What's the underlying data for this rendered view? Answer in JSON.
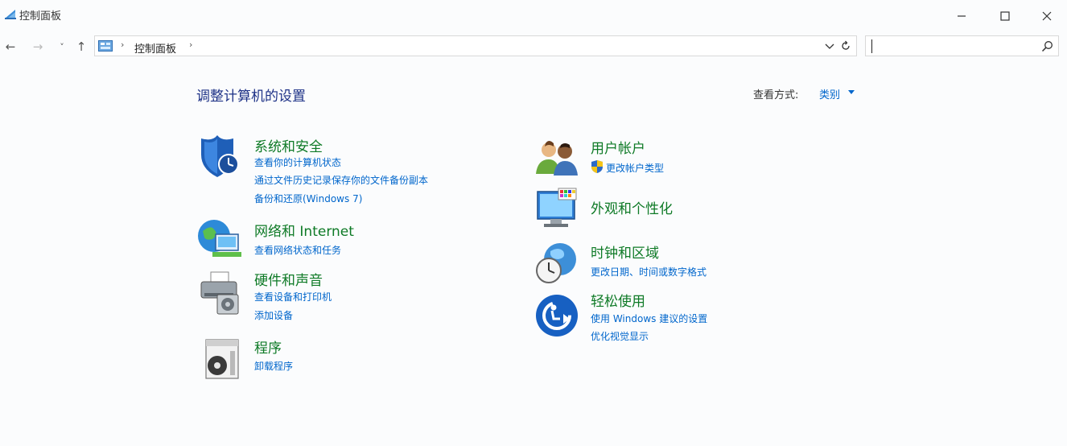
{
  "window": {
    "title": "控制面板",
    "minimize_glyph": "—",
    "maximize_glyph": "☐",
    "close_glyph": "✕"
  },
  "nav": {
    "back": "←",
    "forward": "→",
    "recent": "˅",
    "up": "↑"
  },
  "address": {
    "breadcrumb": "控制面板",
    "separator": "›"
  },
  "search": {
    "value": "",
    "placeholder": ""
  },
  "main": {
    "heading": "调整计算机的设置",
    "view_by_label": "查看方式:",
    "view_by_value": "类别"
  },
  "categories_left": [
    {
      "title": "系统和安全",
      "icon": "shield-icon",
      "links": [
        "查看你的计算机状态",
        "通过文件历史记录保存你的文件备份副本",
        "备份和还原(Windows 7)"
      ]
    },
    {
      "title": "网络和 Internet",
      "icon": "network-globe-icon",
      "links": [
        "查看网络状态和任务"
      ]
    },
    {
      "title": "硬件和声音",
      "icon": "printer-speaker-icon",
      "links": [
        "查看设备和打印机",
        "添加设备"
      ]
    },
    {
      "title": "程序",
      "icon": "programs-disc-icon",
      "links": [
        "卸载程序"
      ]
    }
  ],
  "categories_right": [
    {
      "title": "用户帐户",
      "icon": "users-icon",
      "links": [
        "更改帐户类型"
      ]
    },
    {
      "title": "外观和个性化",
      "icon": "monitor-palette-icon",
      "links": []
    },
    {
      "title": "时钟和区域",
      "icon": "clock-globe-icon",
      "links": [
        "更改日期、时间或数字格式"
      ]
    },
    {
      "title": "轻松使用",
      "icon": "ease-of-access-icon",
      "links": [
        "使用 Windows 建议的设置",
        "优化视觉显示"
      ]
    }
  ],
  "colors": {
    "category_title": "#0e7a26",
    "link": "#0066cc",
    "heading": "#1e3287"
  }
}
